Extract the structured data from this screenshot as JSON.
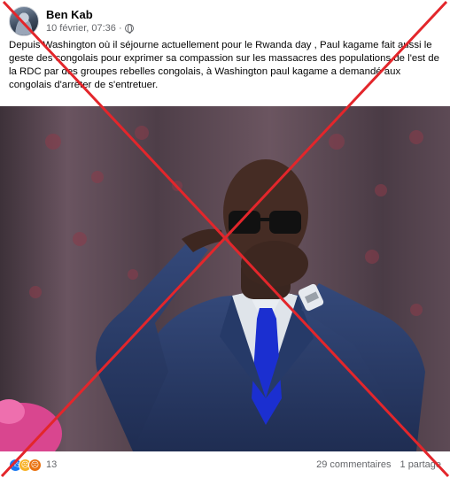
{
  "post": {
    "author": "Ben Kab",
    "timestamp": "10 février, 07:36 ·",
    "privacy_icon": "globe-icon",
    "text": "Depuis Washington où il séjourne actuellement pour le Rwanda day , Paul kagame fait aussi le geste des congolais pour exprimer sa compassion sur les massacres des populations de l'est de la RDC par des groupes rebelles congolais, à Washington paul kagame a demandé aux congolais d'arrêter de s'entretuer."
  },
  "footer": {
    "reaction_icons": [
      "like-icon",
      "sad-icon",
      "angry-icon"
    ],
    "reaction_count": "13",
    "comments": "29 commentaires",
    "shares": "1 partage"
  },
  "overlay": {
    "cross_color": "#e3262b"
  },
  "colors": {
    "suit": "#2b3d68",
    "tie": "#1b2fd0",
    "curtain": "#5a4650"
  }
}
